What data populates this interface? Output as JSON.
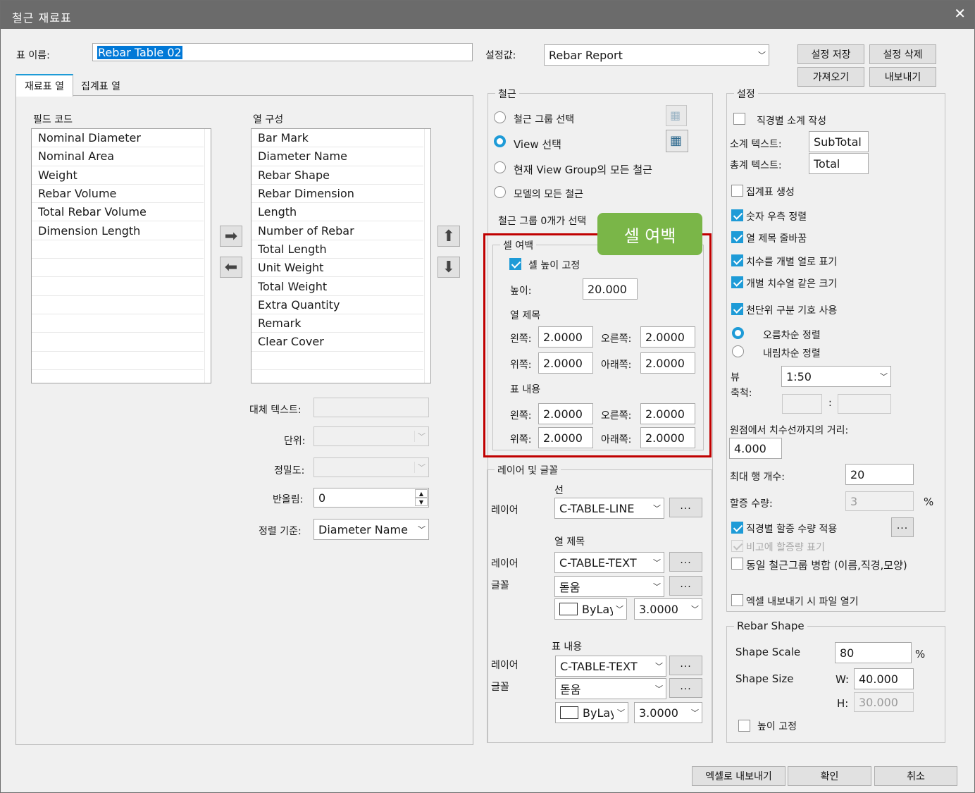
{
  "window": {
    "title": "철근 재료표"
  },
  "header": {
    "table_name_label": "표 이름:",
    "table_name_value": "Rebar Table 02",
    "preset_label": "설정값:",
    "preset_value": "Rebar Report",
    "save_button": "설정 저장",
    "delete_button": "설정 삭제",
    "import_button": "가져오기",
    "export_button": "내보내기"
  },
  "tabs": [
    {
      "label": "재료표 열"
    },
    {
      "label": "집계표 열"
    }
  ],
  "field_codes": {
    "label": "필드 코드",
    "items": [
      "Nominal Diameter",
      "Nominal Area",
      "Weight",
      "Rebar Volume",
      "Total Rebar Volume",
      "Dimension Length"
    ]
  },
  "columns": {
    "label": "열 구성",
    "items": [
      "Bar Mark",
      "Diameter Name",
      "Rebar Shape",
      "Rebar Dimension",
      "Length",
      "Number of Rebar",
      "Total Length",
      "Unit Weight",
      "Total Weight",
      "Extra Quantity",
      "Remark",
      "Clear Cover"
    ]
  },
  "column_props": {
    "alt_text_label": "대체 텍스트:",
    "unit_label": "단위:",
    "precision_label": "정밀도:",
    "rounding_label": "반올림:",
    "rounding_value": "0",
    "sort_label": "정렬 기준:",
    "sort_value": "Diameter Name"
  },
  "rebar": {
    "title": "철근",
    "options": [
      "철근 그룹 선택",
      "View 선택",
      "현재 View Group의 모든 철근",
      "모델의 모든 철근"
    ],
    "selected_index": 1,
    "status": "철근 그룹 0개가 선택"
  },
  "cell_margin": {
    "title": "셀 여백",
    "badge": "셀 여백",
    "fix_height_label": "셀 높이 고정",
    "height_label": "높이:",
    "height_value": "20.000",
    "column_title_label": "열 제목",
    "table_content_label": "표 내용",
    "left_label": "왼쪽:",
    "right_label": "오른쪽:",
    "top_label": "위쪽:",
    "bottom_label": "아래쪽:",
    "title_left": "2.0000",
    "title_right": "2.0000",
    "title_top": "2.0000",
    "title_bottom": "2.0000",
    "content_left": "2.0000",
    "content_right": "2.0000",
    "content_top": "2.0000",
    "content_bottom": "2.0000"
  },
  "layers": {
    "title": "레이어 및 글꼴",
    "line_label": "선",
    "layer_label": "레이어",
    "font_label": "글꼴",
    "line_layer": "C-TABLE-LINE",
    "col_title_label": "열 제목",
    "col_title_layer": "C-TABLE-TEXT",
    "col_title_font": "돋움",
    "col_title_color": "ByLayer",
    "col_title_size": "3.0000",
    "content_label": "표 내용",
    "content_layer": "C-TABLE-TEXT",
    "content_font": "돋움",
    "content_color": "ByLayer",
    "content_size": "3.0000",
    "dots": "..."
  },
  "settings": {
    "title": "설정",
    "subtotal_by_dia": "직경별 소계 작성",
    "subtotal_text_label": "소계 텍스트:",
    "subtotal_text": "SubTotal",
    "total_text_label": "총계 텍스트:",
    "total_text": "Total",
    "summary_create": "집계표 생성",
    "number_right_align": "숫자 우측 정렬",
    "column_title_wrap": "열 제목 줄바꿈",
    "dim_separate_col": "치수를 개별 열로 표기",
    "same_size_cols": "개별 치수열 같은 크기",
    "thousand_sep": "천단위 구분 기호 사용",
    "ascending": "오름차순 정렬",
    "descending": "내림차순 정렬",
    "view_scale_label_1": "뷰",
    "view_scale_label_2": "축척:",
    "view_scale": "1:50",
    "colon": ":",
    "origin_dist_label": "원점에서 치수선까지의 거리:",
    "origin_dist": "4.000",
    "max_rows_label": "최대 행 개수:",
    "max_rows": "20",
    "extra_qty_label": "할증 수량:",
    "extra_qty": "3",
    "percent": "%",
    "apply_extra_by_dia": "직경별 할증 수량 적용",
    "show_extra_in_remark": "비고에 할증량 표기",
    "merge_same_group": "동일 철근그룹 병합 (이름,직경,모양)",
    "open_after_export": "엑셀 내보내기 시 파일 열기",
    "dots": "..."
  },
  "rebar_shape": {
    "title": "Rebar Shape",
    "scale_label": "Shape Scale",
    "scale_value": "80",
    "percent": "%",
    "size_label": "Shape Size",
    "w_label": "W:",
    "w_value": "40.000",
    "h_label": "H:",
    "h_value": "30.000",
    "fix_height": "높이 고정"
  },
  "footer": {
    "export_excel": "엑셀로 내보내기",
    "ok": "확인",
    "cancel": "취소"
  },
  "colors": {
    "accent": "#1e9bd7",
    "highlight": "#c00000",
    "badge": "#7ab648",
    "titlebar": "#6b6b6b"
  }
}
